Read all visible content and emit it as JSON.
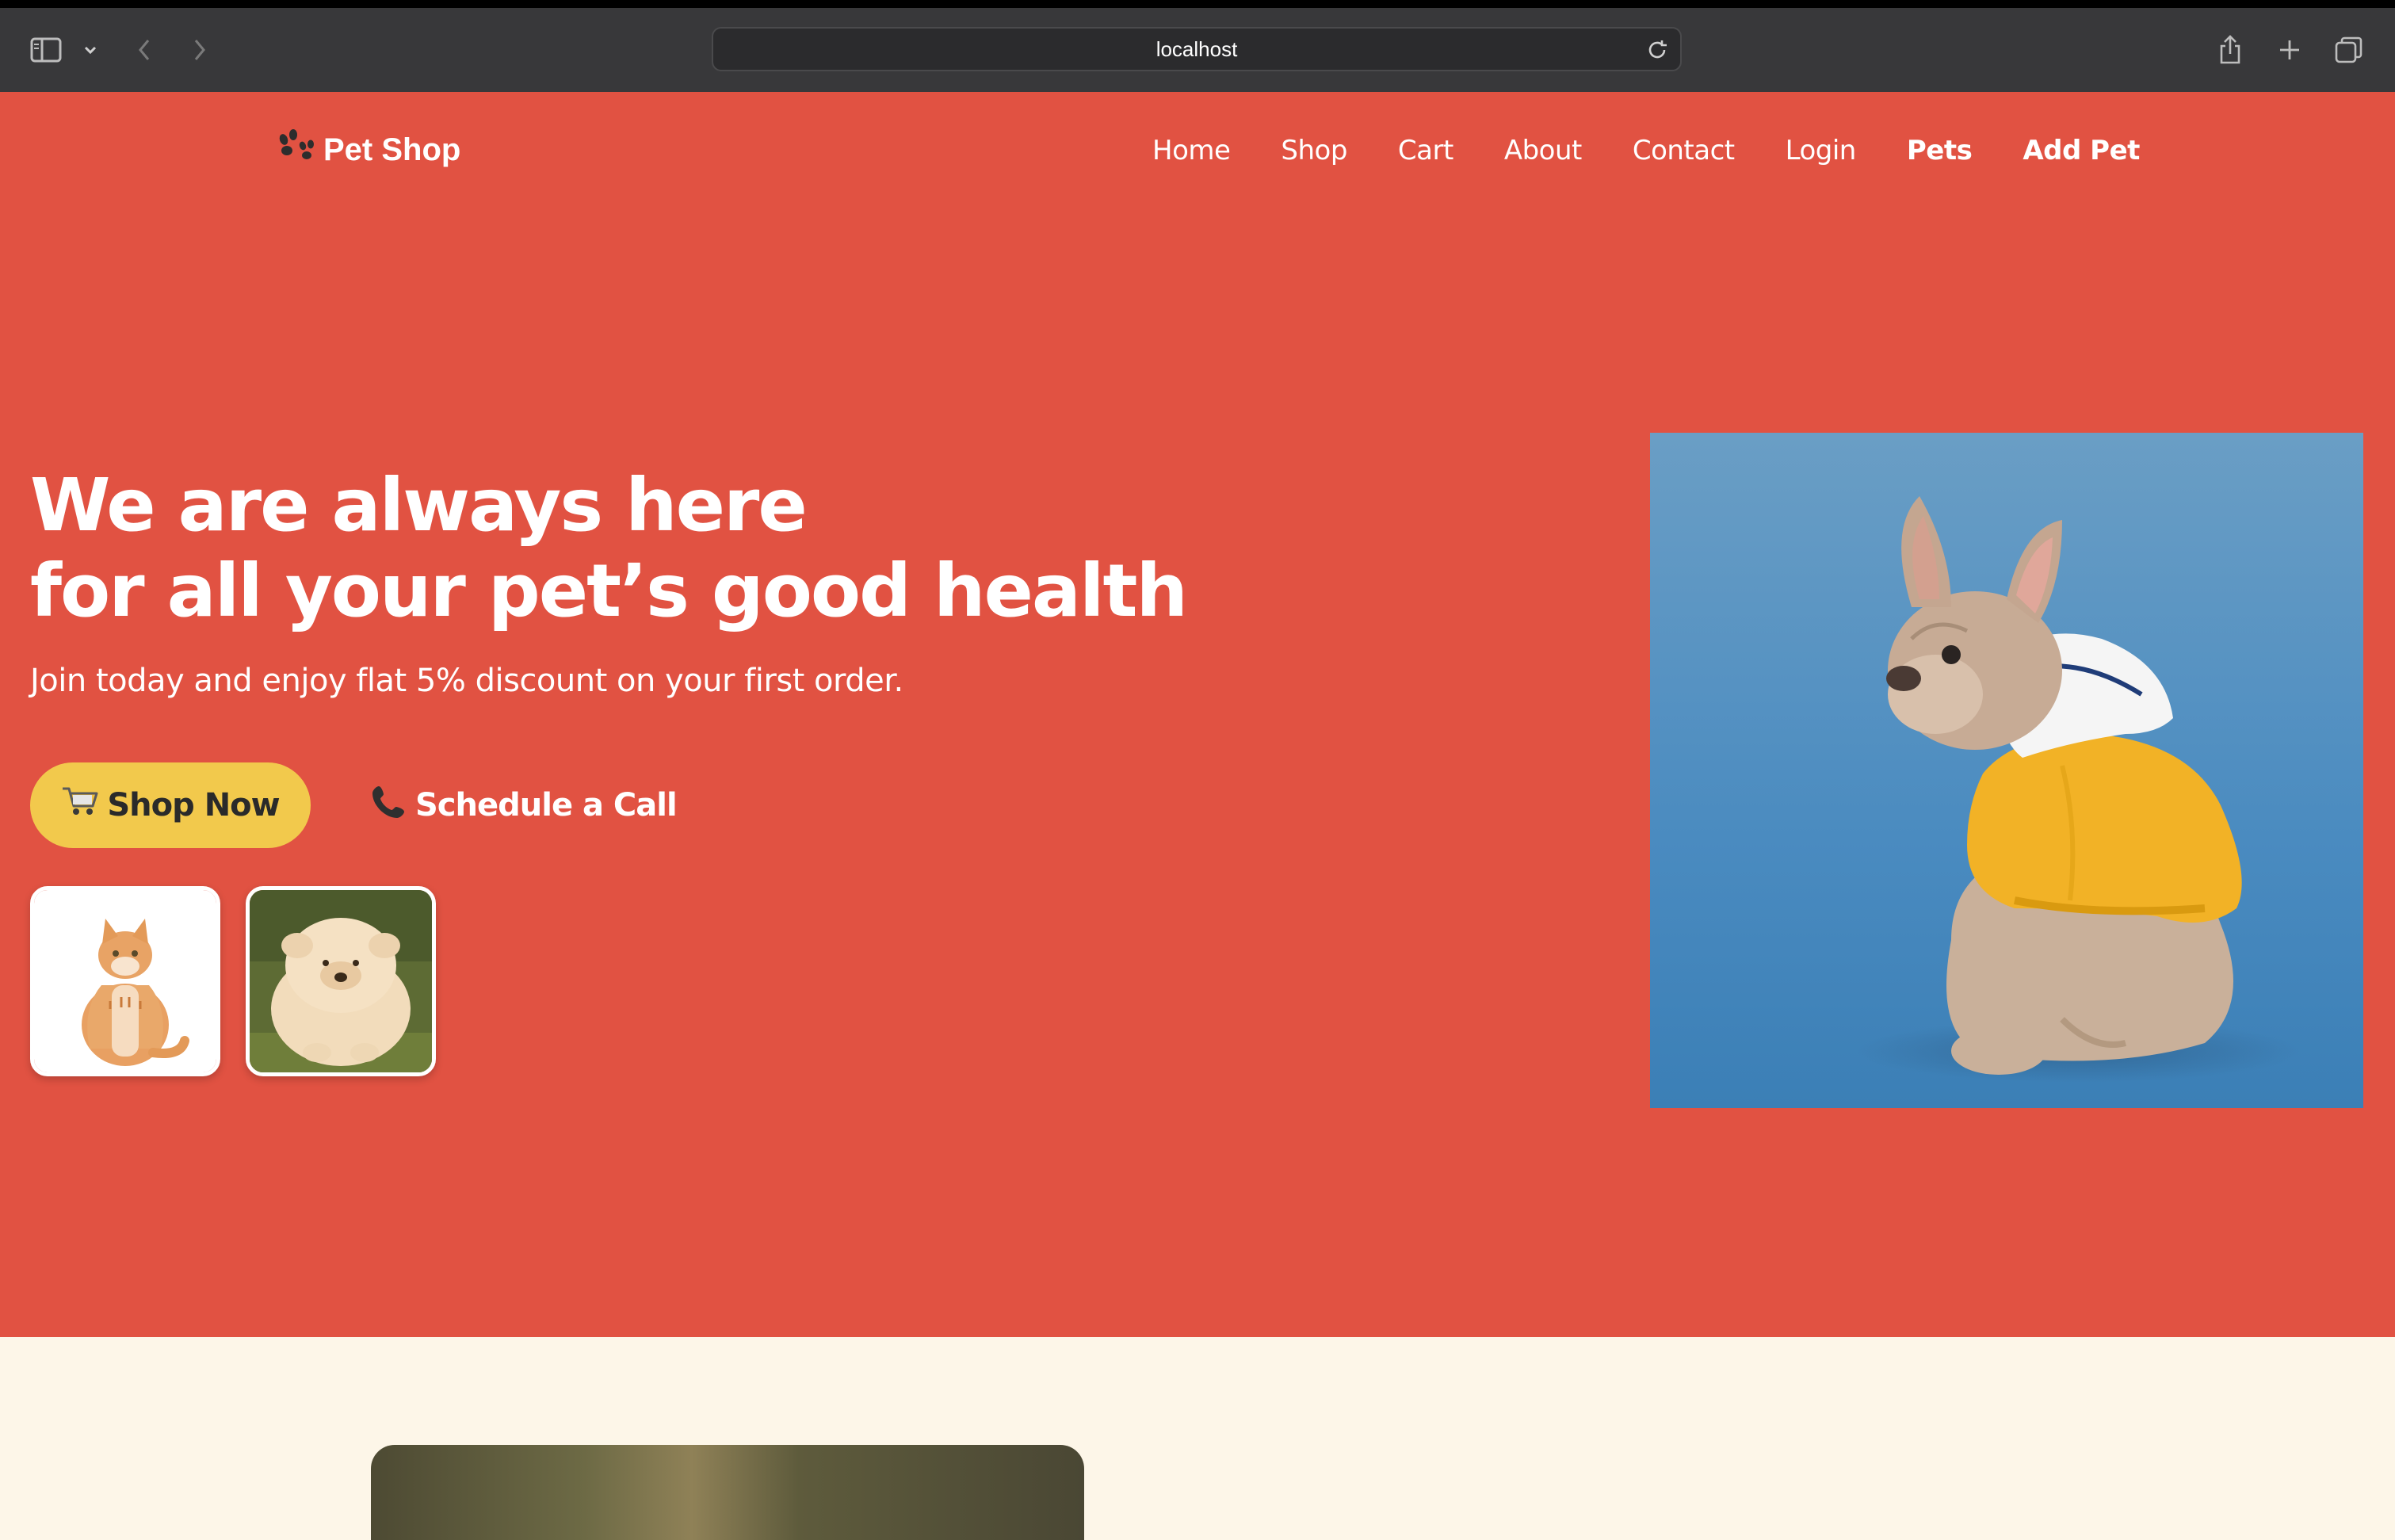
{
  "browser": {
    "url": "localhost"
  },
  "header": {
    "logo_text": "Pet Shop",
    "logo_icon": "paw-icon",
    "nav": [
      {
        "label": "Home"
      },
      {
        "label": "Shop"
      },
      {
        "label": "Cart"
      },
      {
        "label": "About"
      },
      {
        "label": "Contact"
      },
      {
        "label": "Login"
      },
      {
        "label": "Pets"
      },
      {
        "label": "Add Pet"
      }
    ]
  },
  "hero": {
    "headline_line1": "We are always here",
    "headline_line2": "for all your pet’s good health",
    "subline": "Join today and enjoy flat 5% discount on your first order.",
    "shop_button": "Shop Now",
    "shop_button_icon": "cart-icon",
    "call_button": "Schedule a Call",
    "call_button_icon": "phone-icon",
    "thumbnails": [
      "cat-photo",
      "fluffy-dog-photo"
    ],
    "main_photo": "french-bulldog-photo"
  },
  "colors": {
    "hero_bg": "#e15242",
    "button_yellow": "#f2c94c",
    "section_bg": "#fdf6e8",
    "chrome_bg": "#38383a"
  }
}
